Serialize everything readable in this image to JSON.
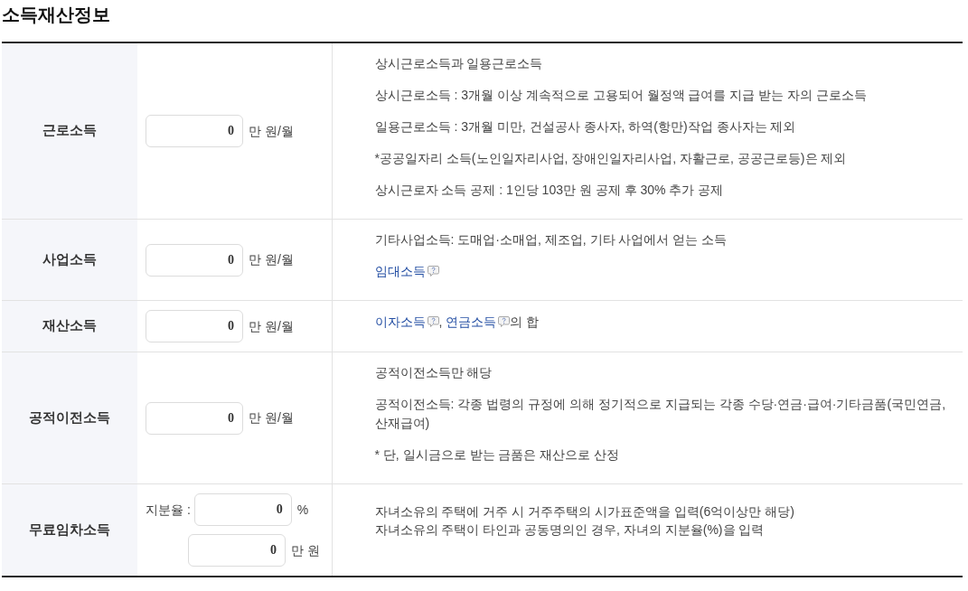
{
  "title": "소득재산정보",
  "rows": [
    {
      "label": "근로소득",
      "fields": [
        {
          "value": "0",
          "unit": "만 원/월"
        }
      ],
      "description": [
        {
          "kind": "text",
          "text": "상시근로소득과 일용근로소득"
        },
        {
          "kind": "text",
          "text": "상시근로소득 : 3개월 이상 계속적으로 고용되어 월정액 급여를 지급 받는 자의 근로소득"
        },
        {
          "kind": "text",
          "text": "일용근로소득 : 3개월 미만, 건설공사 종사자, 하역(항만)작업 종사자는 제외"
        },
        {
          "kind": "text",
          "text": "*공공일자리 소득(노인일자리사업, 장애인일자리사업, 자활근로, 공공근로등)은 제외"
        },
        {
          "kind": "text",
          "text": "상시근로자 소득 공제 : 1인당 103만 원 공제 후 30% 추가 공제"
        }
      ]
    },
    {
      "label": "사업소득",
      "fields": [
        {
          "value": "0",
          "unit": "만 원/월"
        }
      ],
      "description": [
        {
          "kind": "text",
          "text": "기타사업소득: 도매업·소매업, 제조업, 기타 사업에서 얻는 소득"
        },
        {
          "kind": "links",
          "terms": [
            {
              "link": "임대소득"
            }
          ]
        }
      ]
    },
    {
      "label": "재산소득",
      "fields": [
        {
          "value": "0",
          "unit": "만 원/월"
        }
      ],
      "description": [
        {
          "kind": "links",
          "terms": [
            {
              "link": "이자소득",
              "after": ","
            },
            {
              "link": "연금소득",
              "after": "의 합"
            }
          ]
        }
      ]
    },
    {
      "label": "공적이전소득",
      "fields": [
        {
          "value": "0",
          "unit": "만 원/월"
        }
      ],
      "description": [
        {
          "kind": "text",
          "text": "공적이전소득만 해당"
        },
        {
          "kind": "text",
          "text": "공적이전소득: 각종 법령의 규정에 의해 정기적으로 지급되는 각종 수당·연금·급여·기타금품(국민연금, 산재급여)"
        },
        {
          "kind": "text",
          "text": "* 단, 일시금으로 받는 금품은 재산으로 산정"
        }
      ]
    },
    {
      "label": "무료임차소득",
      "fields": [
        {
          "label": "지분율 :",
          "value": "0",
          "unit": "%"
        },
        {
          "value": "0",
          "unit": "만 원"
        }
      ],
      "description": [
        {
          "kind": "lines",
          "lines": [
            "자녀소유의 주택에 거주 시 거주주택의 시가표준액을 입력(6억이상만 해당)",
            "자녀소유의 주택이 타인과 공동명의인 경우, 자녀의 지분율(%)을 입력"
          ]
        }
      ]
    }
  ]
}
